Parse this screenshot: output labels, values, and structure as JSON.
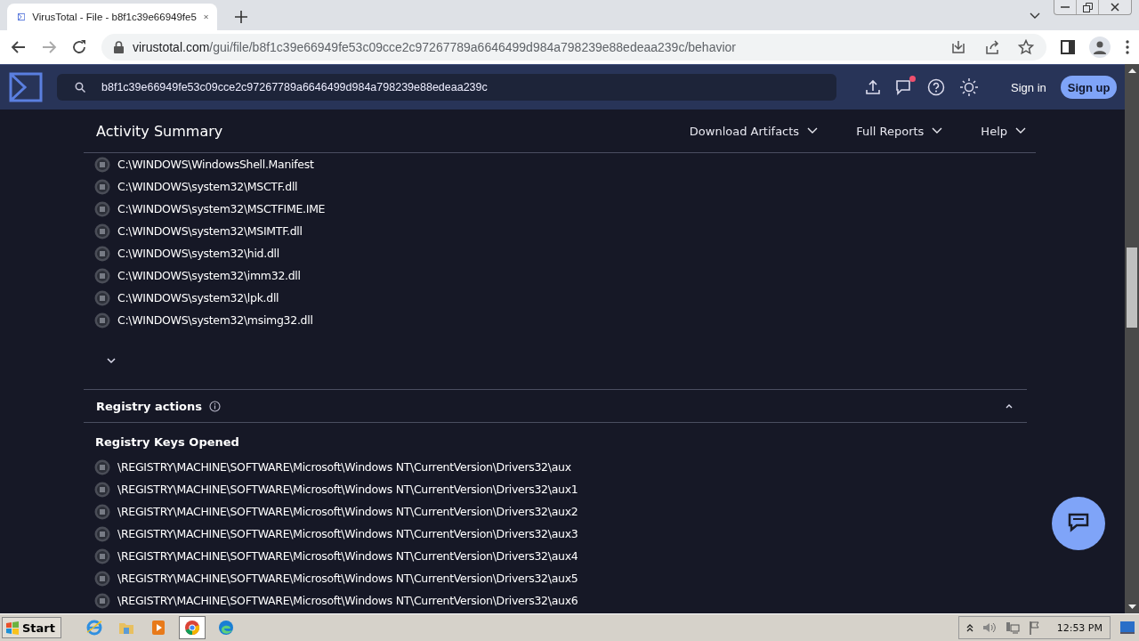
{
  "browser": {
    "tab": {
      "title": "VirusTotal - File - b8f1c39e66949fe5",
      "selected": true
    },
    "url": {
      "host": "virustotal.com",
      "path": "/gui/file/b8f1c39e66949fe53c09cce2c97267789a6646499d984a798239e88edeaa239c/behavior"
    }
  },
  "header": {
    "search": {
      "value": "b8f1c39e66949fe53c09cce2c97267789a6646499d984a798239e88edeaa239c"
    },
    "notification": true,
    "sign_in": "Sign in",
    "sign_up": "Sign up"
  },
  "summary": {
    "title": "Activity Summary",
    "menus": [
      "Download Artifacts",
      "Full Reports",
      "Help"
    ]
  },
  "files": [
    "C:\\WINDOWS\\WindowsShell.Manifest",
    "C:\\WINDOWS\\system32\\MSCTF.dll",
    "C:\\WINDOWS\\system32\\MSCTFIME.IME",
    "C:\\WINDOWS\\system32\\MSIMTF.dll",
    "C:\\WINDOWS\\system32\\hid.dll",
    "C:\\WINDOWS\\system32\\imm32.dll",
    "C:\\WINDOWS\\system32\\lpk.dll",
    "C:\\WINDOWS\\system32\\msimg32.dll"
  ],
  "registry": {
    "title": "Registry actions",
    "expanded": true,
    "subtitle": "Registry Keys Opened",
    "keys": [
      "\\REGISTRY\\MACHINE\\SOFTWARE\\Microsoft\\Windows NT\\CurrentVersion\\Drivers32\\aux",
      "\\REGISTRY\\MACHINE\\SOFTWARE\\Microsoft\\Windows NT\\CurrentVersion\\Drivers32\\aux1",
      "\\REGISTRY\\MACHINE\\SOFTWARE\\Microsoft\\Windows NT\\CurrentVersion\\Drivers32\\aux2",
      "\\REGISTRY\\MACHINE\\SOFTWARE\\Microsoft\\Windows NT\\CurrentVersion\\Drivers32\\aux3",
      "\\REGISTRY\\MACHINE\\SOFTWARE\\Microsoft\\Windows NT\\CurrentVersion\\Drivers32\\aux4",
      "\\REGISTRY\\MACHINE\\SOFTWARE\\Microsoft\\Windows NT\\CurrentVersion\\Drivers32\\aux5",
      "\\REGISTRY\\MACHINE\\SOFTWARE\\Microsoft\\Windows NT\\CurrentVersion\\Drivers32\\aux6"
    ]
  },
  "taskbar": {
    "start": "Start",
    "apps": [
      {
        "kind": "ie",
        "selected": false
      },
      {
        "kind": "folder",
        "selected": false
      },
      {
        "kind": "media",
        "selected": false
      },
      {
        "kind": "chrome",
        "selected": true
      },
      {
        "kind": "edge",
        "selected": false
      }
    ],
    "clock": "12:53 PM"
  }
}
